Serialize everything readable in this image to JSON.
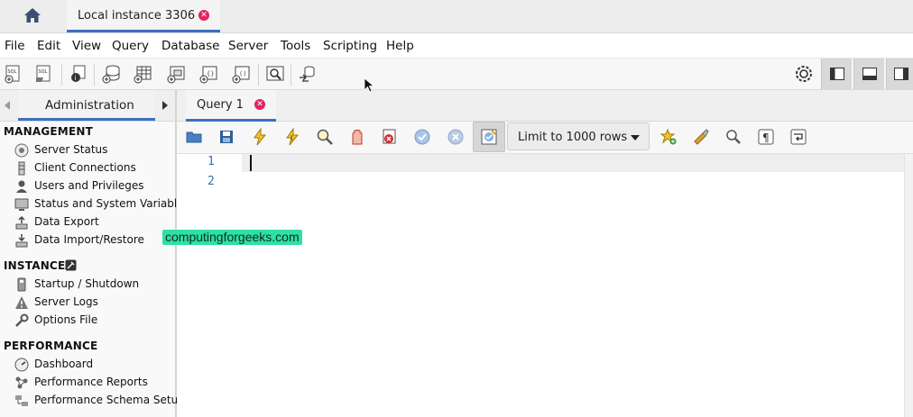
{
  "window": {
    "connection_tab": "Local instance 3306"
  },
  "menu": [
    "File",
    "Edit",
    "View",
    "Query",
    "Database",
    "Server",
    "Tools",
    "Scripting",
    "Help"
  ],
  "toolbar": {
    "icons": [
      "new-sql-tab-icon",
      "open-sql-script-icon",
      "inspect-object-icon",
      "create-schema-icon",
      "create-table-icon",
      "create-view-icon",
      "create-procedure-icon",
      "create-function-icon",
      "search-table-data-icon",
      "reconnect-icon",
      "preferences-icon",
      "toggle-sidebar-icon",
      "toggle-output-icon",
      "toggle-secondary-sidebar-icon"
    ]
  },
  "sidebar": {
    "tab_label": "Administration",
    "sections": {
      "management": {
        "title": "MANAGEMENT",
        "items": [
          "Server Status",
          "Client Connections",
          "Users and Privileges",
          "Status and System Variables",
          "Data Export",
          "Data Import/Restore"
        ]
      },
      "instance": {
        "title": "INSTANCE",
        "items": [
          "Startup / Shutdown",
          "Server Logs",
          "Options File"
        ]
      },
      "performance": {
        "title": "PERFORMANCE",
        "items": [
          "Dashboard",
          "Performance Reports",
          "Performance Schema Setup"
        ]
      }
    }
  },
  "query": {
    "tab_label": "Query 1",
    "limit_select": "Limit to 1000 rows",
    "line_numbers": [
      "1",
      "2"
    ]
  },
  "watermark": "computingforgeeks.com",
  "colors": {
    "accent": "#3b6fbf",
    "close": "#e0245e",
    "watermark_bg": "#2ee0a6",
    "line_number": "#3a6fb0"
  }
}
